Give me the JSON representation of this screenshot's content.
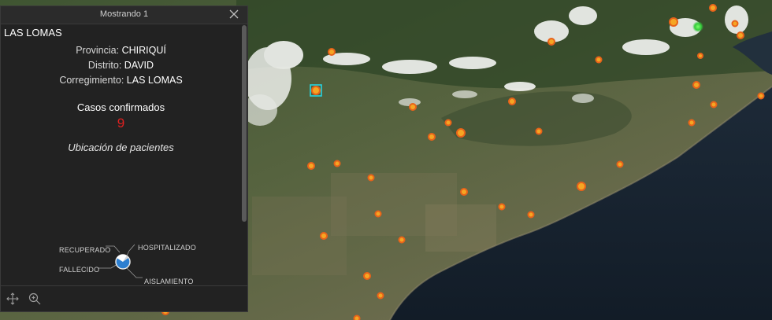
{
  "popup": {
    "title": "Mostrando 1",
    "feature_name": "LAS LOMAS",
    "provincia_label": "Provincia:",
    "provincia_value": "CHIRIQUÍ",
    "distrito_label": "Distrito:",
    "distrito_value": "DAVID",
    "corregimiento_label": "Corregimiento:",
    "corregimiento_value": "LAS LOMAS",
    "cases_label": "Casos confirmados",
    "cases_value": "9",
    "patients_label": "Ubicación de pacientes",
    "pie_labels": {
      "recuperado": "RECUPERADO",
      "hospitalizado": "HOSPITALIZADO",
      "fallecido": "FALLECIDO",
      "aislamiento": "AISLAMIENTO DOMICILIARIO"
    },
    "close_icon": "close-icon",
    "footer_icons": [
      "move-icon",
      "zoom-to-icon"
    ]
  },
  "colors": {
    "case_marker": "#f5a623",
    "case_marker_ring": "#e8631a",
    "recovered_marker": "#3fd04a",
    "selection_box": "#27d3e0",
    "cases_value": "#e02020",
    "pie_primary": "#2d7fd0",
    "pie_secondary": "#ffffff"
  }
}
